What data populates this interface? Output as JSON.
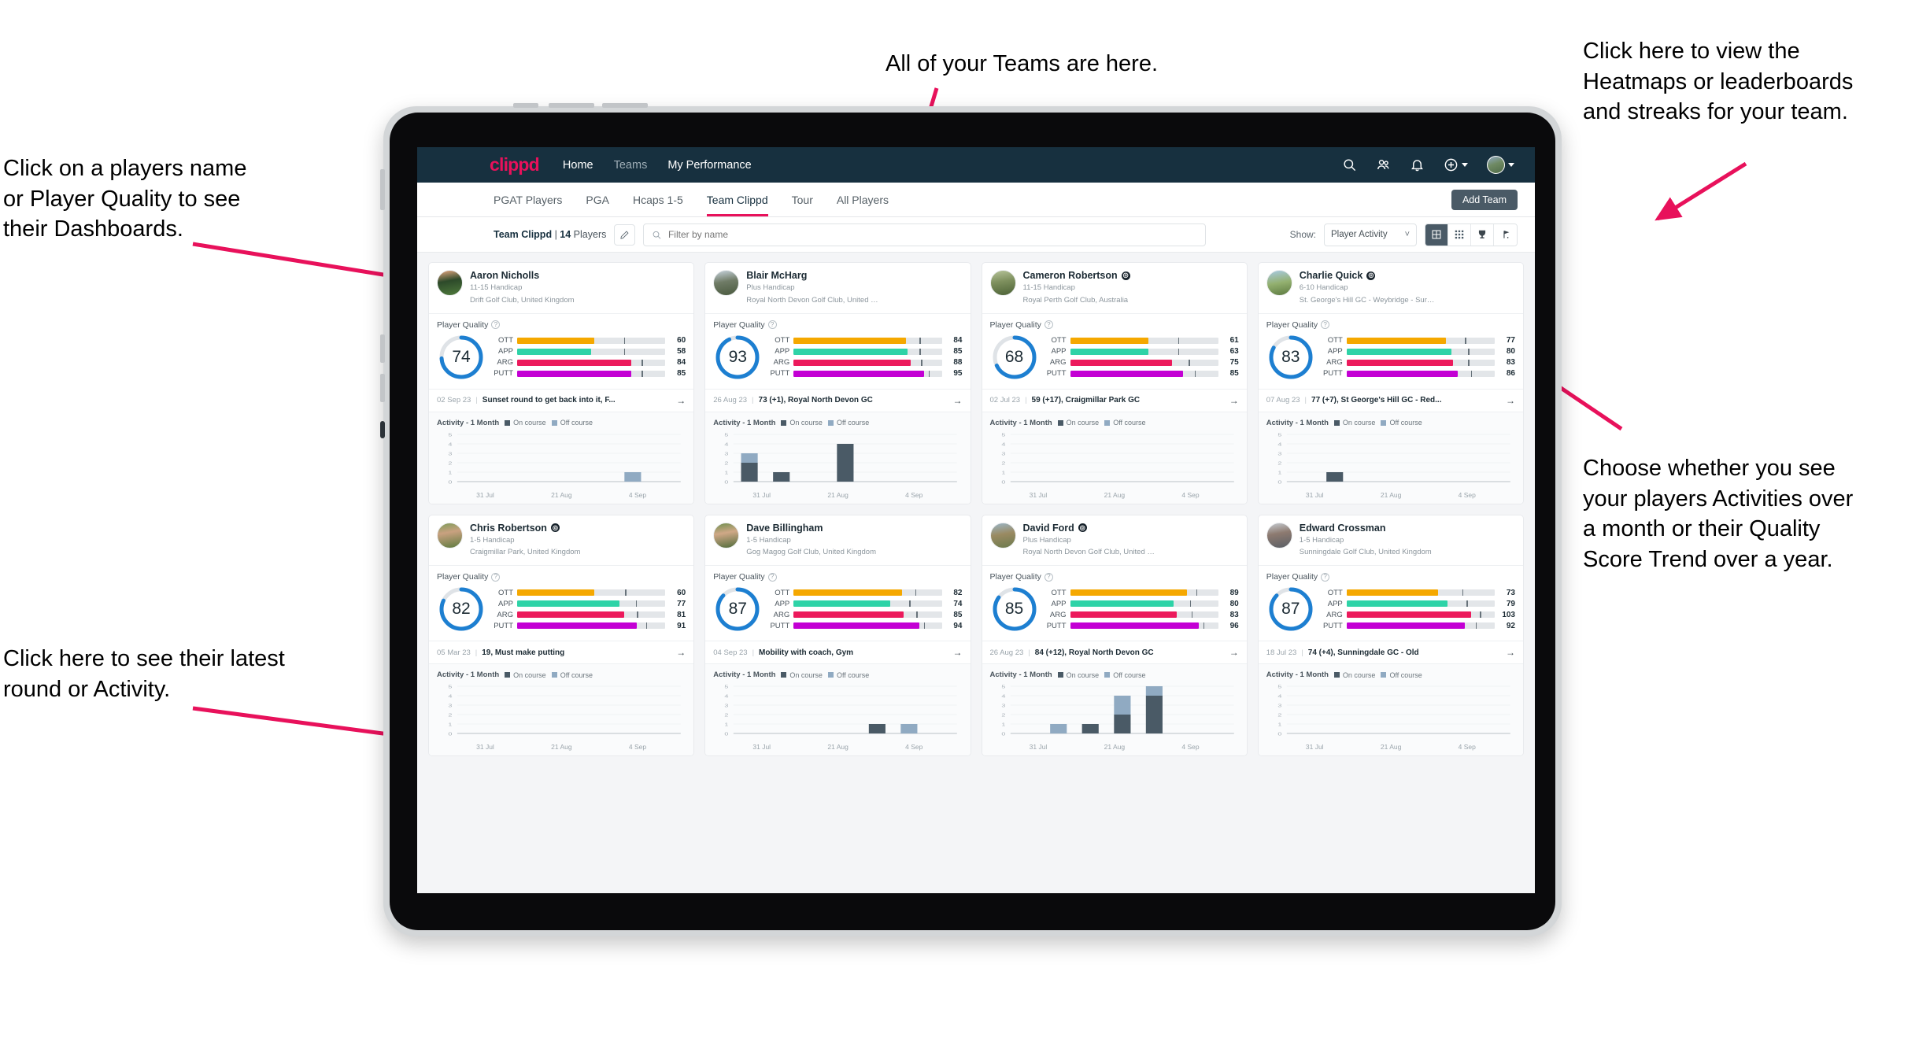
{
  "annotations": {
    "top": "All of your Teams are here.",
    "top_right": "Click here to view the\nHeatmaps or leaderboards\nand streaks for your team.",
    "left": "Click on a players name\nor Player Quality to see\ntheir Dashboards.",
    "right": "Choose whether you see\nyour players Activities over\na month or their Quality\nScore Trend over a year.",
    "bottom_left": "Click here to see their latest\nround or Activity.",
    "accent_color": "#e8115b"
  },
  "navbar": {
    "logo": "clippd",
    "links": [
      {
        "label": "Home",
        "active": true
      },
      {
        "label": "Teams",
        "active": false
      },
      {
        "label": "My Performance",
        "active": false
      }
    ],
    "icons": [
      "search-icon",
      "people-icon",
      "bell-icon",
      "plus-circle-icon",
      "avatar"
    ]
  },
  "subnav": {
    "tabs": [
      {
        "label": "PGAT Players",
        "active": false
      },
      {
        "label": "PGA",
        "active": false
      },
      {
        "label": "Hcaps 1-5",
        "active": false
      },
      {
        "label": "Team Clippd",
        "active": true
      },
      {
        "label": "Tour",
        "active": false
      },
      {
        "label": "All Players",
        "active": false
      }
    ],
    "add_team_label": "Add Team"
  },
  "filterbar": {
    "team_name": "Team Clippd",
    "team_separator": " | ",
    "player_count": "14",
    "players_word": " Players",
    "search_placeholder": "Filter by name",
    "search_value": "",
    "show_label": "Show:",
    "show_value": "Player Activity",
    "show_options": [
      "Player Activity",
      "Quality Score Trend"
    ],
    "view_buttons": [
      {
        "name": "grid-view-icon",
        "active": true
      },
      {
        "name": "heatmap-view-icon",
        "active": false
      },
      {
        "name": "leaderboard-trophy-icon",
        "active": false
      },
      {
        "name": "streaks-flag-icon",
        "active": false
      }
    ]
  },
  "card_labels": {
    "player_quality": "Player Quality",
    "activity": "Activity - 1 Month",
    "legend_on": "On course",
    "legend_off": "Off course",
    "metric_labels": [
      "OTT",
      "APP",
      "ARG",
      "PUTT"
    ],
    "x_ticks": [
      "31 Jul",
      "21 Aug",
      "4 Sep"
    ],
    "y_ticks": [
      "5",
      "4",
      "3",
      "2",
      "1",
      "0"
    ]
  },
  "metric_colors": {
    "OTT": "#f5a800",
    "APP": "#2ed3a7",
    "ARG": "#ec1a5c",
    "PUTT": "#c300d4",
    "track": "#e3e6e9",
    "donut": "#1d7fd1",
    "on_course": "#4a5a66",
    "off_course": "#90aac2"
  },
  "players": [
    {
      "name": "Aaron Nicholls",
      "verified": false,
      "handicap": "11-15 Handicap",
      "club": "Drift Golf Club, United Kingdom",
      "quality": 74,
      "metrics": [
        {
          "label": "OTT",
          "value": 60,
          "fill": 52,
          "tick": 72
        },
        {
          "label": "APP",
          "value": 58,
          "fill": 50,
          "tick": 72
        },
        {
          "label": "ARG",
          "value": 84,
          "fill": 77,
          "tick": 84
        },
        {
          "label": "PUTT",
          "value": 85,
          "fill": 77,
          "tick": 84
        }
      ],
      "latest_date": "02 Sep 23",
      "latest_text": "Sunset round to get back into it, F...",
      "avatar_gradient": "linear-gradient(170deg,#e8a882 0%,#2d4a2a 42%,#4f7a3c 100%)",
      "activity": [
        {
          "on": 0,
          "off": 0
        },
        {
          "on": 0,
          "off": 0
        },
        {
          "on": 0,
          "off": 0
        },
        {
          "on": 0,
          "off": 0
        },
        {
          "on": 0,
          "off": 0
        },
        {
          "on": 0,
          "off": 1
        },
        {
          "on": 0,
          "off": 0
        }
      ]
    },
    {
      "name": "Blair McHarg",
      "verified": false,
      "handicap": "Plus Handicap",
      "club": "Royal North Devon Golf Club, United Kin...",
      "quality": 93,
      "metrics": [
        {
          "label": "OTT",
          "value": 84,
          "fill": 76,
          "tick": 85
        },
        {
          "label": "APP",
          "value": 85,
          "fill": 77,
          "tick": 85
        },
        {
          "label": "ARG",
          "value": 88,
          "fill": 79,
          "tick": 86
        },
        {
          "label": "PUTT",
          "value": 95,
          "fill": 88,
          "tick": 91
        }
      ],
      "latest_date": "26 Aug 23",
      "latest_text": "73 (+1), Royal North Devon GC",
      "avatar_gradient": "linear-gradient(170deg,#c8d4de 0%,#6f7b66 45%,#4a5a3f 100%)",
      "activity": [
        {
          "on": 2,
          "off": 1
        },
        {
          "on": 1,
          "off": 0
        },
        {
          "on": 0,
          "off": 0
        },
        {
          "on": 4,
          "off": 0
        },
        {
          "on": 0,
          "off": 0
        },
        {
          "on": 0,
          "off": 0
        },
        {
          "on": 0,
          "off": 0
        }
      ]
    },
    {
      "name": "Cameron Robertson",
      "verified": true,
      "handicap": "11-15 Handicap",
      "club": "Royal Perth Golf Club, Australia",
      "quality": 68,
      "metrics": [
        {
          "label": "OTT",
          "value": 61,
          "fill": 53,
          "tick": 73
        },
        {
          "label": "APP",
          "value": 63,
          "fill": 53,
          "tick": 73
        },
        {
          "label": "ARG",
          "value": 75,
          "fill": 69,
          "tick": 80
        },
        {
          "label": "PUTT",
          "value": 85,
          "fill": 76,
          "tick": 84
        }
      ],
      "latest_date": "02 Jul 23",
      "latest_text": "59 (+17), Craigmillar Park GC",
      "avatar_gradient": "linear-gradient(170deg,#b7c49a 0%,#7d8f5d 45%,#4c6236 100%)",
      "activity": [
        {
          "on": 0,
          "off": 0
        },
        {
          "on": 0,
          "off": 0
        },
        {
          "on": 0,
          "off": 0
        },
        {
          "on": 0,
          "off": 0
        },
        {
          "on": 0,
          "off": 0
        },
        {
          "on": 0,
          "off": 0
        },
        {
          "on": 0,
          "off": 0
        }
      ]
    },
    {
      "name": "Charlie Quick",
      "verified": true,
      "handicap": "6-10 Handicap",
      "club": "St. George's Hill GC - Weybridge - Surrey, ...",
      "quality": 83,
      "metrics": [
        {
          "label": "OTT",
          "value": 77,
          "fill": 67,
          "tick": 80
        },
        {
          "label": "APP",
          "value": 80,
          "fill": 71,
          "tick": 82
        },
        {
          "label": "ARG",
          "value": 83,
          "fill": 72,
          "tick": 82
        },
        {
          "label": "PUTT",
          "value": 86,
          "fill": 75,
          "tick": 84
        }
      ],
      "latest_date": "07 Aug 23",
      "latest_text": "77 (+7), St George's Hill GC - Red...",
      "avatar_gradient": "linear-gradient(170deg,#a9cbe4 0%,#93b06f 50%,#5c7a40 100%)",
      "activity": [
        {
          "on": 0,
          "off": 0
        },
        {
          "on": 1,
          "off": 0
        },
        {
          "on": 0,
          "off": 0
        },
        {
          "on": 0,
          "off": 0
        },
        {
          "on": 0,
          "off": 0
        },
        {
          "on": 0,
          "off": 0
        },
        {
          "on": 0,
          "off": 0
        }
      ]
    },
    {
      "name": "Chris Robertson",
      "verified": true,
      "handicap": "1-5 Handicap",
      "club": "Craigmillar Park, United Kingdom",
      "quality": 82,
      "metrics": [
        {
          "label": "OTT",
          "value": 60,
          "fill": 52,
          "tick": 73
        },
        {
          "label": "APP",
          "value": 77,
          "fill": 69,
          "tick": 80
        },
        {
          "label": "ARG",
          "value": 81,
          "fill": 72,
          "tick": 81
        },
        {
          "label": "PUTT",
          "value": 91,
          "fill": 81,
          "tick": 87
        }
      ],
      "latest_date": "05 Mar 23",
      "latest_text": "19, Must make putting",
      "avatar_gradient": "linear-gradient(170deg,#7e9c5a 0%,#c9a180 38%,#5d7a3e 100%)",
      "activity": [
        {
          "on": 0,
          "off": 0
        },
        {
          "on": 0,
          "off": 0
        },
        {
          "on": 0,
          "off": 0
        },
        {
          "on": 0,
          "off": 0
        },
        {
          "on": 0,
          "off": 0
        },
        {
          "on": 0,
          "off": 0
        },
        {
          "on": 0,
          "off": 0
        }
      ]
    },
    {
      "name": "Dave Billingham",
      "verified": false,
      "handicap": "1-5 Handicap",
      "club": "Gog Magog Golf Club, United Kingdom",
      "quality": 87,
      "metrics": [
        {
          "label": "OTT",
          "value": 82,
          "fill": 73,
          "tick": 82
        },
        {
          "label": "APP",
          "value": 74,
          "fill": 65,
          "tick": 78
        },
        {
          "label": "ARG",
          "value": 85,
          "fill": 74,
          "tick": 83
        },
        {
          "label": "PUTT",
          "value": 94,
          "fill": 85,
          "tick": 88
        }
      ],
      "latest_date": "04 Sep 23",
      "latest_text": "Mobility with coach, Gym",
      "avatar_gradient": "linear-gradient(170deg,#6f8f4f 0%,#d0a887 40%,#4f6b3a 100%)",
      "activity": [
        {
          "on": 0,
          "off": 0
        },
        {
          "on": 0,
          "off": 0
        },
        {
          "on": 0,
          "off": 0
        },
        {
          "on": 0,
          "off": 0
        },
        {
          "on": 1,
          "off": 0
        },
        {
          "on": 0,
          "off": 1
        },
        {
          "on": 0,
          "off": 0
        }
      ]
    },
    {
      "name": "David Ford",
      "verified": true,
      "handicap": "Plus Handicap",
      "club": "Royal North Devon Golf Club, United Kin...",
      "quality": 85,
      "metrics": [
        {
          "label": "OTT",
          "value": 89,
          "fill": 79,
          "tick": 85
        },
        {
          "label": "APP",
          "value": 80,
          "fill": 70,
          "tick": 81
        },
        {
          "label": "ARG",
          "value": 83,
          "fill": 72,
          "tick": 82
        },
        {
          "label": "PUTT",
          "value": 96,
          "fill": 87,
          "tick": 90
        }
      ],
      "latest_date": "26 Aug 23",
      "latest_text": "84 (+12), Royal North Devon GC",
      "avatar_gradient": "linear-gradient(170deg,#9bb7c9 0%,#9a8a62 45%,#6b7a4d 100%)",
      "activity": [
        {
          "on": 0,
          "off": 0
        },
        {
          "on": 0,
          "off": 1
        },
        {
          "on": 1,
          "off": 0
        },
        {
          "on": 2,
          "off": 2
        },
        {
          "on": 4,
          "off": 1
        },
        {
          "on": 0,
          "off": 0
        },
        {
          "on": 0,
          "off": 0
        }
      ]
    },
    {
      "name": "Edward Crossman",
      "verified": false,
      "handicap": "1-5 Handicap",
      "club": "Sunningdale Golf Club, United Kingdom",
      "quality": 87,
      "metrics": [
        {
          "label": "OTT",
          "value": 73,
          "fill": 62,
          "tick": 78
        },
        {
          "label": "APP",
          "value": 79,
          "fill": 68,
          "tick": 81
        },
        {
          "label": "ARG",
          "value": 103,
          "fill": 84,
          "tick": 90
        },
        {
          "label": "PUTT",
          "value": 92,
          "fill": 80,
          "tick": 87
        }
      ],
      "latest_date": "18 Jul 23",
      "latest_text": "74 (+4), Sunningdale GC - Old",
      "avatar_gradient": "linear-gradient(170deg,#c6ccd2 0%,#8d7a70 42%,#5a5f66 100%)",
      "activity": [
        {
          "on": 0,
          "off": 0
        },
        {
          "on": 0,
          "off": 0
        },
        {
          "on": 0,
          "off": 0
        },
        {
          "on": 0,
          "off": 0
        },
        {
          "on": 0,
          "off": 0
        },
        {
          "on": 0,
          "off": 0
        },
        {
          "on": 0,
          "off": 0
        }
      ]
    }
  ]
}
